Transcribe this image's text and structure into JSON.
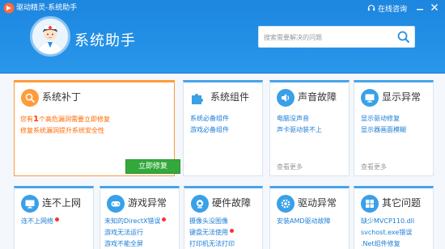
{
  "window": {
    "title": "驱动精灵-系统助手",
    "online_consult": "在线咨询"
  },
  "header": {
    "page_title": "系统助手",
    "search_placeholder": "搜索需要解决的问题"
  },
  "patch_card": {
    "title": "系统补丁",
    "line1_prefix": "您有",
    "line1_count": "1",
    "line1_suffix": "个高危漏洞需要立即修复",
    "line2": "修复系统漏洞提升系统安全性",
    "fix_button": "立即修复"
  },
  "component_card": {
    "title": "系统组件",
    "links": [
      "系统必备组件",
      "游戏必备组件"
    ]
  },
  "sound_card": {
    "title": "声音故障",
    "links": [
      "电脑没声音",
      "声卡驱动装不上"
    ],
    "more": "查看更多"
  },
  "display_card": {
    "title": "显示异常",
    "links": [
      "显示驱动修复",
      "显示器画面模糊"
    ],
    "more": "查看更多"
  },
  "network_card": {
    "title": "连不上网",
    "links": [
      "连不上网络"
    ]
  },
  "game_card": {
    "title": "游戏异常",
    "links": [
      "未知的DirectX错误",
      "游戏无法运行",
      "游戏不能全屏"
    ]
  },
  "hardware_card": {
    "title": "硬件故障",
    "links": [
      "摄像头没图像",
      "键盘无法使用",
      "打印机无法打印"
    ]
  },
  "driver_card": {
    "title": "驱动异常",
    "links": [
      "安装AMD驱动故障"
    ]
  },
  "other_card": {
    "title": "其它问题",
    "links": [
      "缺少MVCP110.dll",
      "svchost.exe错误",
      ".Net组件修复"
    ]
  },
  "colors": {
    "header_blue": "#2390e6",
    "card_accent_blue": "#47a5e9",
    "patch_orange": "#ff9c3a",
    "fix_green": "#33a93b",
    "link_blue": "#1c7ed6"
  }
}
